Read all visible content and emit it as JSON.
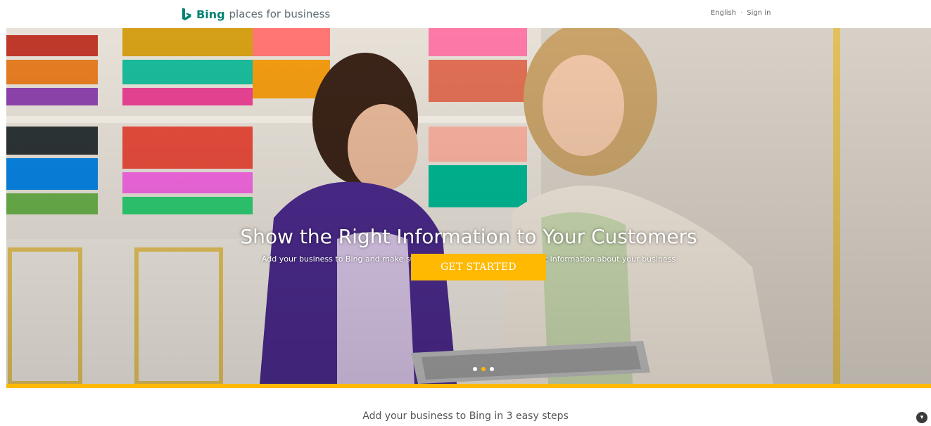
{
  "header": {
    "brand_bold": "Bing",
    "brand_rest": "places for business",
    "language": "English",
    "sign_in": "Sign in"
  },
  "hero": {
    "title": "Show the Right Information to Your Customers",
    "subtitle": "Add your business to Bing and make sure customers always find the right information about your business",
    "cta_label": "GET STARTED",
    "carousel": {
      "count": 3,
      "active_index": 1
    }
  },
  "footer": {
    "steps_title": "Add your business to Bing in 3 easy steps"
  },
  "colors": {
    "accent": "#ffb900",
    "brand": "#008373"
  },
  "icons": {
    "logo": "bing-logo-icon",
    "scroll": "chevron-down-icon"
  }
}
